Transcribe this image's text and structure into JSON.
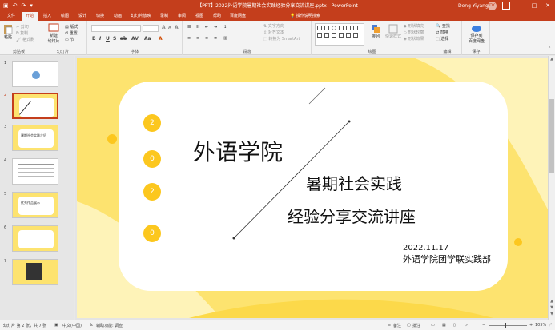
{
  "window": {
    "title": "【PPT】2022外语学院暑期社会实践经验分享交流讲座.pptx - PowerPoint",
    "user": "Deng Yiyang",
    "avatar_initials": "DY"
  },
  "tabs": {
    "items": [
      {
        "label": "文件"
      },
      {
        "label": "开始"
      },
      {
        "label": "插入"
      },
      {
        "label": "绘图"
      },
      {
        "label": "设计"
      },
      {
        "label": "切换"
      },
      {
        "label": "动画"
      },
      {
        "label": "幻灯片放映"
      },
      {
        "label": "录制"
      },
      {
        "label": "审阅"
      },
      {
        "label": "视图"
      },
      {
        "label": "帮助"
      },
      {
        "label": "百度网盘"
      }
    ],
    "tell_me": "操作说明搜索"
  },
  "ribbon": {
    "paste": "粘贴",
    "cut": "剪切",
    "copy": "复制",
    "format_painter": "格式刷",
    "new_slide": "新建",
    "new_slide_2": "幻灯片",
    "layout": "版式",
    "reset": "重置",
    "section": "节",
    "text_direction": "文字方向",
    "align_text": "对齐文本",
    "convert_smartart": "转换为 SmartArt",
    "arrange": "排列",
    "quick_styles": "快速样式",
    "shape_fill": "形状填充",
    "shape_outline": "形状轮廓",
    "shape_effects": "形状效果",
    "find": "查找",
    "replace": "替换",
    "select": "选择",
    "save_baidu": "保存到",
    "save_baidu_2": "百度网盘",
    "groups": {
      "clipboard": "剪贴板",
      "slides": "幻灯片",
      "font": "字体",
      "paragraph": "段落",
      "drawing": "绘图",
      "editing": "编辑",
      "save": "保存"
    }
  },
  "slides": {
    "thumbs": [
      {
        "num": "1"
      },
      {
        "num": "2"
      },
      {
        "num": "3",
        "text": "暑期社会实践介绍"
      },
      {
        "num": "4"
      },
      {
        "num": "5",
        "text": "优秀作品展示"
      },
      {
        "num": "6"
      },
      {
        "num": "7"
      }
    ]
  },
  "slide": {
    "numbers": [
      "2",
      "0",
      "2",
      "0"
    ],
    "title": "外语学院",
    "subtitle1": "暑期社会实践",
    "subtitle2": "经验分享交流讲座",
    "date": "2022.11.17",
    "org": "外语学院团学联实践部"
  },
  "status": {
    "slide_info": "幻灯片 第 2 张，共 7 张",
    "language": "中文(中国)",
    "accessibility": "辅助功能: 调查",
    "notes": "备注",
    "comments": "批注",
    "zoom": "105%",
    "zoom_minus": "−",
    "zoom_plus": "+"
  }
}
